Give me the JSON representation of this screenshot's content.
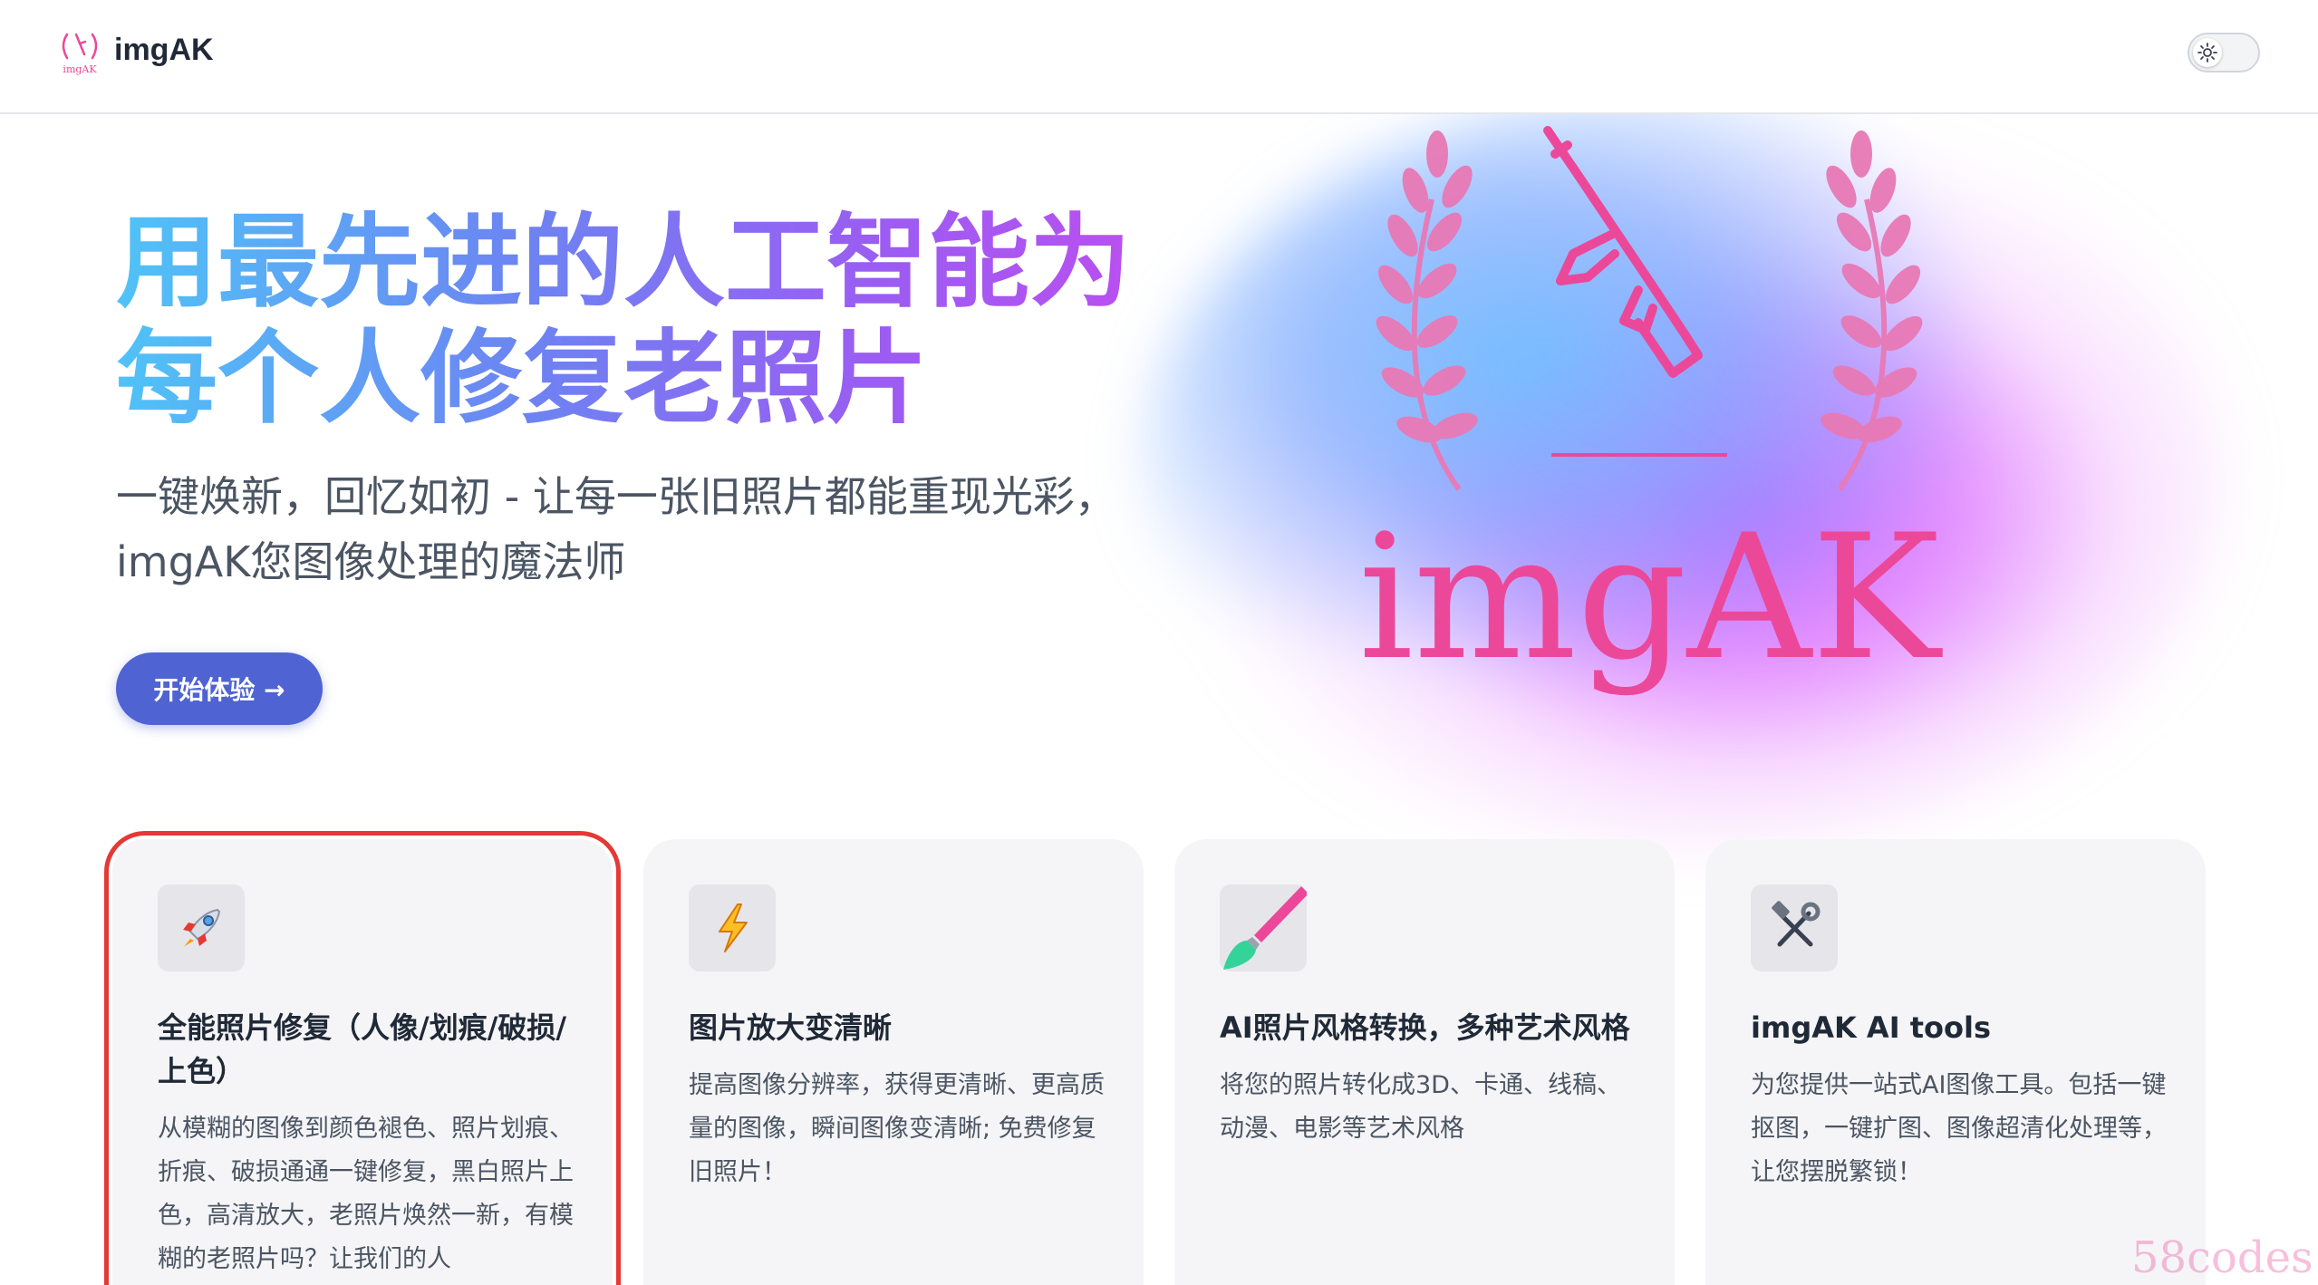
{
  "header": {
    "logo_text": "imgAK",
    "brand_name": "imgAK"
  },
  "theme_toggle": {
    "icon": "sun-icon",
    "state": "light"
  },
  "hero": {
    "title_line1": "用最先进的人工智能为",
    "title_line2": "每个人修复老照片",
    "subtitle": "一键焕新，回忆如初 - 让每一张旧照片都能重现光彩，imgAK您图像处理的魔法师",
    "cta_label": "开始体验 →"
  },
  "emblem": {
    "wordmark": "imgAK",
    "icon": "rifle-laurel-emblem"
  },
  "features": [
    {
      "icon": "rocket-icon",
      "title": "全能照片修复（人像/划痕/破损/上色）",
      "desc": "从模糊的图像到颜色褪色、照片划痕、折痕、破损通通一键修复，黑白照片上色，高清放大，老照片焕然一新，有模糊的老照片吗？让我们的人"
    },
    {
      "icon": "lightning-icon",
      "title": "图片放大变清晰",
      "desc": "提高图像分辨率，获得更清晰、更高质量的图像，瞬间图像变清晰; 免费修复旧照片！"
    },
    {
      "icon": "paintbrush-icon",
      "title": "AI照片风格转换，多种艺术风格",
      "desc": "将您的照片转化成3D、卡通、线稿、动漫、电影等艺术风格"
    },
    {
      "icon": "hammer-wrench-icon",
      "title": "imgAK AI tools",
      "desc": "为您提供一站式AI图像工具。包括一键抠图，一键扩图、图像超清化处理等，让您摆脱繁锁！"
    }
  ],
  "watermark": "58codes",
  "colors": {
    "accent": "#4f63d2",
    "emblem_pink": "#ec4899",
    "card_background": "#f5f5f7",
    "selection_outline": "#e53935"
  }
}
